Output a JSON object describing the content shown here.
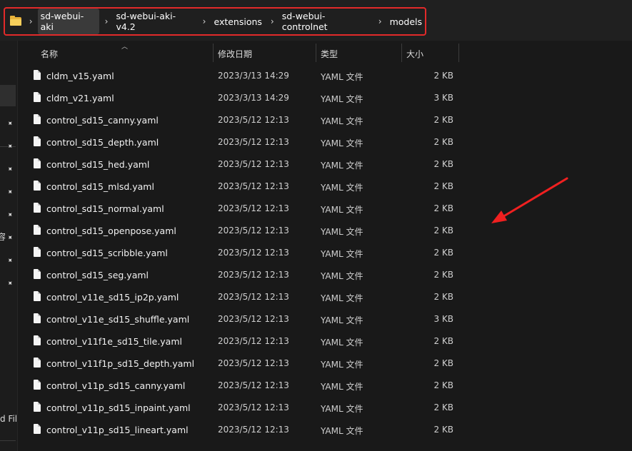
{
  "breadcrumb": [
    "sd-webui-aki",
    "sd-webui-aki-v4.2",
    "extensions",
    "sd-webui-controlnet",
    "models"
  ],
  "columns": {
    "name": "名称",
    "date": "修改日期",
    "type": "类型",
    "size": "大小"
  },
  "nav_fragments": [
    "容",
    "d Fil"
  ],
  "files": [
    {
      "name": "cldm_v15.yaml",
      "date": "2023/3/13 14:29",
      "type": "YAML 文件",
      "size": "2 KB"
    },
    {
      "name": "cldm_v21.yaml",
      "date": "2023/3/13 14:29",
      "type": "YAML 文件",
      "size": "3 KB"
    },
    {
      "name": "control_sd15_canny.yaml",
      "date": "2023/5/12 12:13",
      "type": "YAML 文件",
      "size": "2 KB"
    },
    {
      "name": "control_sd15_depth.yaml",
      "date": "2023/5/12 12:13",
      "type": "YAML 文件",
      "size": "2 KB"
    },
    {
      "name": "control_sd15_hed.yaml",
      "date": "2023/5/12 12:13",
      "type": "YAML 文件",
      "size": "2 KB"
    },
    {
      "name": "control_sd15_mlsd.yaml",
      "date": "2023/5/12 12:13",
      "type": "YAML 文件",
      "size": "2 KB"
    },
    {
      "name": "control_sd15_normal.yaml",
      "date": "2023/5/12 12:13",
      "type": "YAML 文件",
      "size": "2 KB"
    },
    {
      "name": "control_sd15_openpose.yaml",
      "date": "2023/5/12 12:13",
      "type": "YAML 文件",
      "size": "2 KB"
    },
    {
      "name": "control_sd15_scribble.yaml",
      "date": "2023/5/12 12:13",
      "type": "YAML 文件",
      "size": "2 KB"
    },
    {
      "name": "control_sd15_seg.yaml",
      "date": "2023/5/12 12:13",
      "type": "YAML 文件",
      "size": "2 KB"
    },
    {
      "name": "control_v11e_sd15_ip2p.yaml",
      "date": "2023/5/12 12:13",
      "type": "YAML 文件",
      "size": "2 KB"
    },
    {
      "name": "control_v11e_sd15_shuffle.yaml",
      "date": "2023/5/12 12:13",
      "type": "YAML 文件",
      "size": "3 KB"
    },
    {
      "name": "control_v11f1e_sd15_tile.yaml",
      "date": "2023/5/12 12:13",
      "type": "YAML 文件",
      "size": "2 KB"
    },
    {
      "name": "control_v11f1p_sd15_depth.yaml",
      "date": "2023/5/12 12:13",
      "type": "YAML 文件",
      "size": "2 KB"
    },
    {
      "name": "control_v11p_sd15_canny.yaml",
      "date": "2023/5/12 12:13",
      "type": "YAML 文件",
      "size": "2 KB"
    },
    {
      "name": "control_v11p_sd15_inpaint.yaml",
      "date": "2023/5/12 12:13",
      "type": "YAML 文件",
      "size": "2 KB"
    },
    {
      "name": "control_v11p_sd15_lineart.yaml",
      "date": "2023/5/12 12:13",
      "type": "YAML 文件",
      "size": "2 KB"
    }
  ],
  "colors": {
    "highlight_box": "#e32a2a",
    "arrow": "#f02020",
    "folder": "#f6cf5b"
  }
}
